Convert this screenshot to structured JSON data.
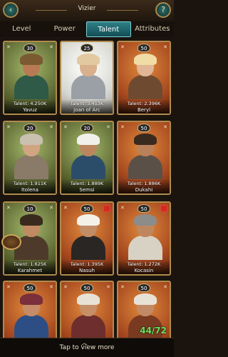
{
  "header": {
    "title": "Vizier"
  },
  "tabs": [
    {
      "label": "Level",
      "active": false
    },
    {
      "label": "Power",
      "active": false
    },
    {
      "label": "Talent",
      "active": true
    },
    {
      "label": "Attributes",
      "active": false
    }
  ],
  "cards": [
    {
      "level": "30",
      "talent": "Talent: 4.250K",
      "name": "Yavuz",
      "bg": "green",
      "hat": "#7b5a32",
      "body": "#2e5a47",
      "skin": "#b77a52",
      "badge": false
    },
    {
      "level": "25",
      "talent": "Talent: 3.413K",
      "name": "Joan of Arc",
      "bg": "white",
      "hat": "#e3c9a0",
      "body": "#9aa0a6",
      "skin": "#d8b08c",
      "badge": false
    },
    {
      "level": "50",
      "talent": "Talent: 2.396K",
      "name": "Beryl",
      "bg": "orange",
      "hat": "#f0dca4",
      "body": "#6e4b30",
      "skin": "#e0b696",
      "badge": false
    },
    {
      "level": "20",
      "talent": "Talent: 1.911K",
      "name": "Itolena",
      "bg": "green",
      "hat": "#c9c0b0",
      "body": "#8a7a68",
      "skin": "#d2a582",
      "badge": false
    },
    {
      "level": "20",
      "talent": "Talent: 1.889K",
      "name": "Semsi",
      "bg": "green",
      "hat": "#f2f0ea",
      "body": "#2c4d6a",
      "skin": "#b98660",
      "badge": false
    },
    {
      "level": "50",
      "talent": "Talent: 1.886K",
      "name": "Dukahi",
      "bg": "orange",
      "hat": "#3a2a1e",
      "body": "#5a5048",
      "skin": "#b9805a",
      "badge": false
    },
    {
      "level": "10",
      "talent": "Talent: 1.625K",
      "name": "Karahmet",
      "bg": "green",
      "hat": "#3a2a1e",
      "body": "#4e3a2a",
      "skin": "#c08a62",
      "badge": false
    },
    {
      "level": "50",
      "talent": "Talent: 1.395K",
      "name": "Nasuh",
      "bg": "orange",
      "hat": "#f4f1e8",
      "body": "#2a2624",
      "skin": "#c28c66",
      "badge": true
    },
    {
      "level": "50",
      "talent": "Talent: 1.272K",
      "name": "Kocasin",
      "bg": "orange",
      "hat": "#8c8c8a",
      "body": "#d8d2c4",
      "skin": "#bf875f",
      "badge": true
    },
    {
      "level": "50",
      "talent": "",
      "name": "",
      "bg": "orange",
      "hat": "#7a2f3a",
      "body": "#2d4e84",
      "skin": "#c48c68",
      "badge": false
    },
    {
      "level": "50",
      "talent": "",
      "name": "",
      "bg": "orange",
      "hat": "#e8e2d6",
      "body": "#6e2e2e",
      "skin": "#c68f68",
      "badge": false
    },
    {
      "level": "50",
      "talent": "",
      "name": "",
      "bg": "orange",
      "hat": "#e8e2d6",
      "body": "#7a3a22",
      "skin": "#c28a64",
      "badge": false
    }
  ],
  "count": "44/72",
  "footer": {
    "label": "Tap to view more"
  },
  "side_button": {
    "text": ""
  }
}
